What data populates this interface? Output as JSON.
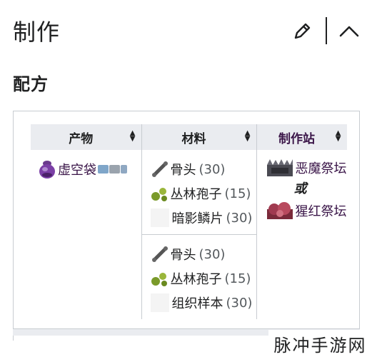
{
  "header": {
    "title": "制作"
  },
  "recipe_section": {
    "title": "配方"
  },
  "table": {
    "columns": [
      {
        "label": "产物"
      },
      {
        "label": "材料"
      },
      {
        "label": "制作站"
      }
    ],
    "product": {
      "name": "虚空袋",
      "platform_icons": [
        "pc-icon",
        "console-icon",
        "mobile-icon"
      ]
    },
    "recipes": [
      {
        "materials": [
          {
            "name": "骨头",
            "qty": "(30)",
            "icon": "bone-icon"
          },
          {
            "name": "丛林孢子",
            "qty": "(15)",
            "icon": "jungle-spores-icon"
          },
          {
            "name": "暗影鳞片",
            "qty": "(30)",
            "icon": "shadow-scale-icon"
          }
        ]
      },
      {
        "materials": [
          {
            "name": "骨头",
            "qty": "(30)",
            "icon": "bone-icon"
          },
          {
            "name": "丛林孢子",
            "qty": "(15)",
            "icon": "jungle-spores-icon"
          },
          {
            "name": "组织样本",
            "qty": "(30)",
            "icon": "tissue-sample-icon"
          }
        ]
      }
    ],
    "stations": {
      "first": "恶魔祭坛",
      "or": "或",
      "second": "猩红祭坛"
    }
  },
  "watermark": "脉冲手游网",
  "colors": {
    "header_bg": "#eaecf0",
    "border": "#c8ccd1",
    "text": "#202122",
    "station_link": "#3a1548"
  }
}
